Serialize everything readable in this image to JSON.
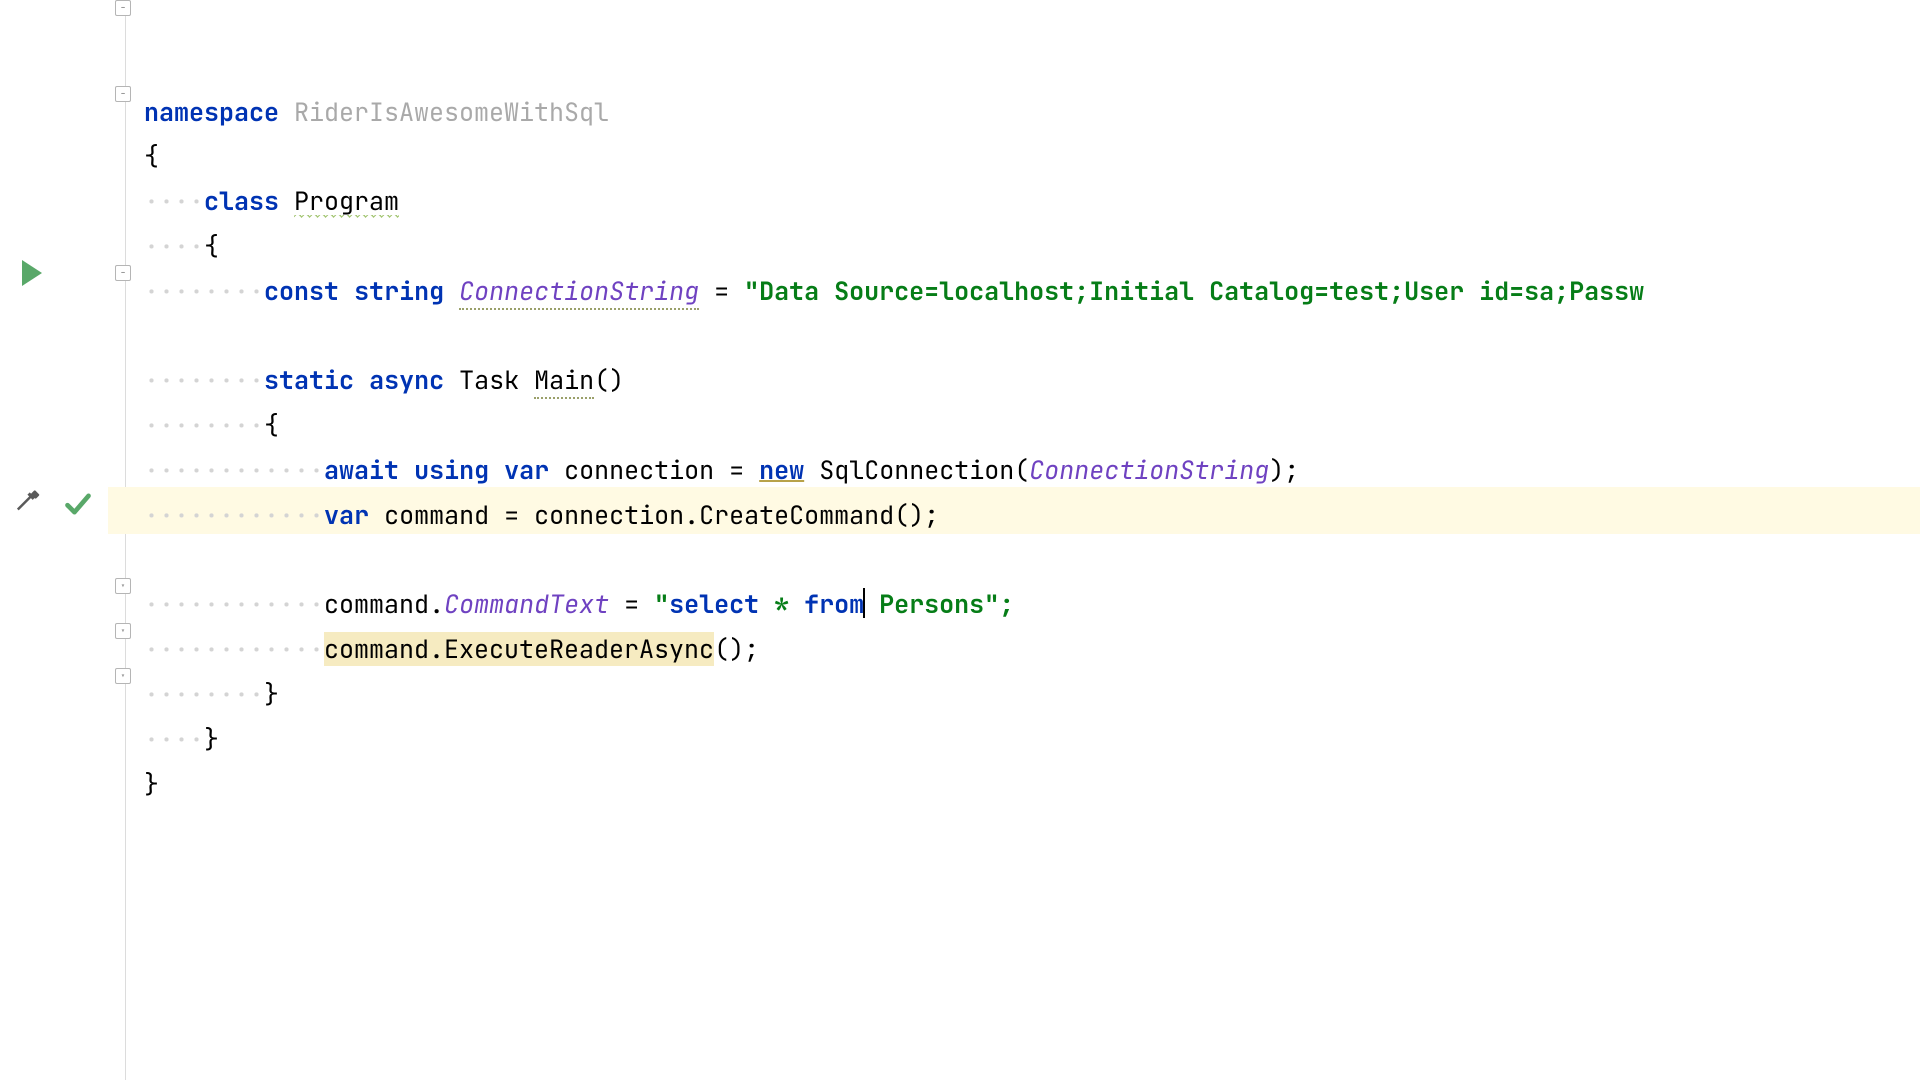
{
  "code": {
    "namespace_kw": "namespace",
    "namespace_name": "RiderIsAwesomeWithSql",
    "brace_open": "{",
    "brace_close": "}",
    "class_kw": "class",
    "class_name": "Program",
    "const_kw": "const",
    "string_kw": "string",
    "conn_str_ident": "ConnectionString",
    "eq": " = ",
    "conn_str_value": "\"Data Source=localhost;Initial Catalog=test;User id=sa;Passw",
    "static_kw": "static",
    "async_kw": "async",
    "task_type": "Task",
    "main_ident": "Main",
    "parens": "()",
    "await_kw": "await",
    "using_kw": "using",
    "var_kw": "var",
    "connection_ident": "connection",
    "new_kw": "new",
    "sqlconn_type": "SqlConnection",
    "open_paren": "(",
    "close_paren_semi": ");",
    "command_ident": "command",
    "create_cmd": "connection.CreateCommand();",
    "commandtext_prop": "CommandText",
    "sql_open_quote": "\"",
    "sql_select": "select",
    "sql_star": " * ",
    "sql_from": "from",
    "sql_persons": " Persons",
    "sql_close": "\";",
    "exec_reader": "command.ExecuteReaderAsync",
    "exec_tail": "();",
    "semi": ";",
    "dot": "."
  },
  "gutter": {
    "run_tooltip": "Run",
    "hammer_tooltip": "Edit",
    "check_tooltip": "OK"
  },
  "indent_unit": "····"
}
